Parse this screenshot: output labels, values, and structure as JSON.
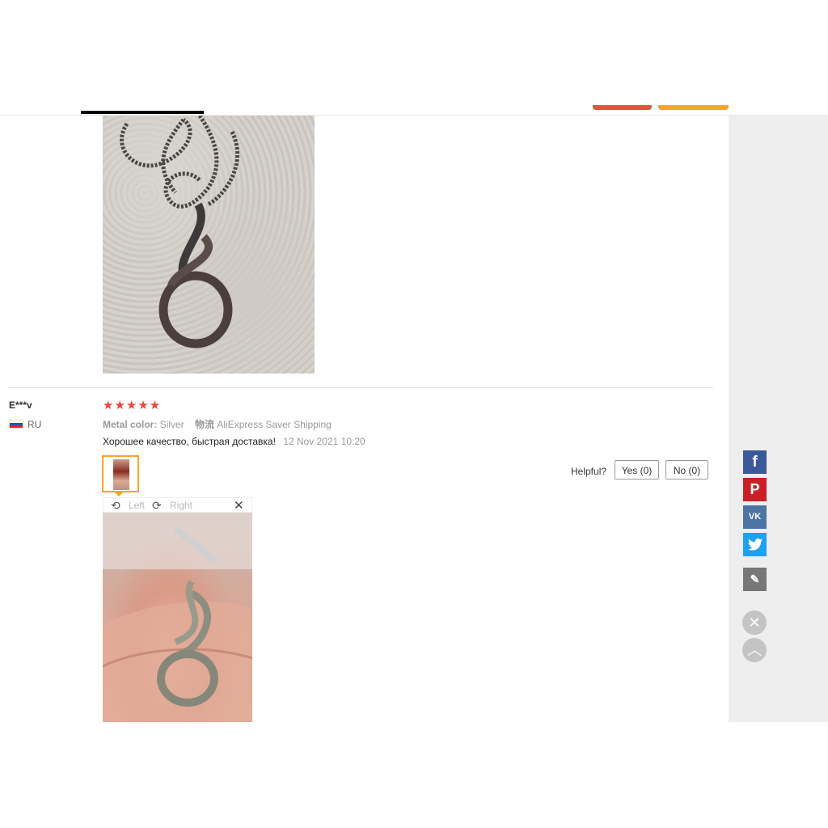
{
  "review": {
    "reviewer": "E***v",
    "country": "RU",
    "stars": "★★★★★",
    "meta": {
      "color_label": "Metal color:",
      "color_value": "Silver",
      "shipping_label": "物流",
      "shipping_value": "AliExpress Saver Shipping"
    },
    "text": "Хорошее качество, быстрая доставка!",
    "date": "12 Nov 2021 10:20",
    "rating": 5
  },
  "image_viewer": {
    "rotate_left": "Left",
    "rotate_right": "Right",
    "close": "✕"
  },
  "helpful": {
    "label": "Helpful?",
    "yes": "Yes (0)",
    "no": "No (0)"
  },
  "share": {
    "facebook": "f",
    "pinterest": "P",
    "vk": "VK",
    "twitter": "🐦",
    "edit": "✎",
    "close": "✕",
    "up": "︿"
  },
  "colors": {
    "star": "#f44336",
    "thumb_border": "#f5a623",
    "facebook": "#3b5998",
    "pinterest": "#cb2027",
    "vk": "#4c75a3",
    "twitter": "#1da1f2"
  }
}
